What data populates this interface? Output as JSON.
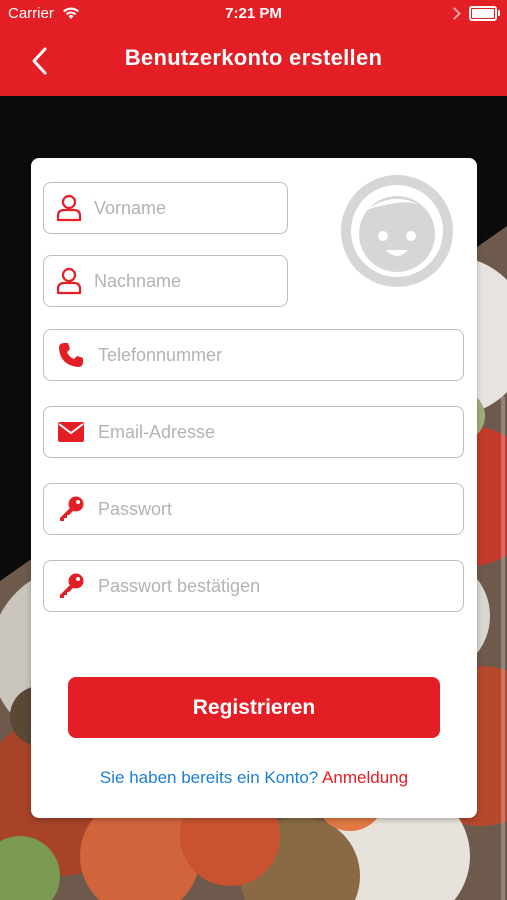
{
  "status_bar": {
    "carrier": "Carrier",
    "time": "7:21 PM"
  },
  "header": {
    "title": "Benutzerkonto erstellen",
    "back_icon": "chevron-left-icon"
  },
  "form": {
    "first_name": {
      "placeholder": "Vorname",
      "icon": "user-icon"
    },
    "last_name": {
      "placeholder": "Nachname",
      "icon": "user-icon"
    },
    "phone": {
      "placeholder": "Telefonnummer",
      "icon": "phone-icon"
    },
    "email": {
      "placeholder": "Email-Adresse",
      "icon": "envelope-icon"
    },
    "password": {
      "placeholder": "Passwort",
      "icon": "key-icon"
    },
    "password_confirm": {
      "placeholder": "Passwort bestätigen",
      "icon": "key-icon"
    },
    "avatar_icon": "avatar-placeholder-icon",
    "register_label": "Registrieren",
    "login_question": "Sie haben bereits ein Konto?",
    "login_link": "Anmeldung"
  },
  "colors": {
    "accent": "#e31e24",
    "link": "#1a7fd6",
    "placeholder": "#b3b3b3",
    "border": "#bdbdbd"
  }
}
